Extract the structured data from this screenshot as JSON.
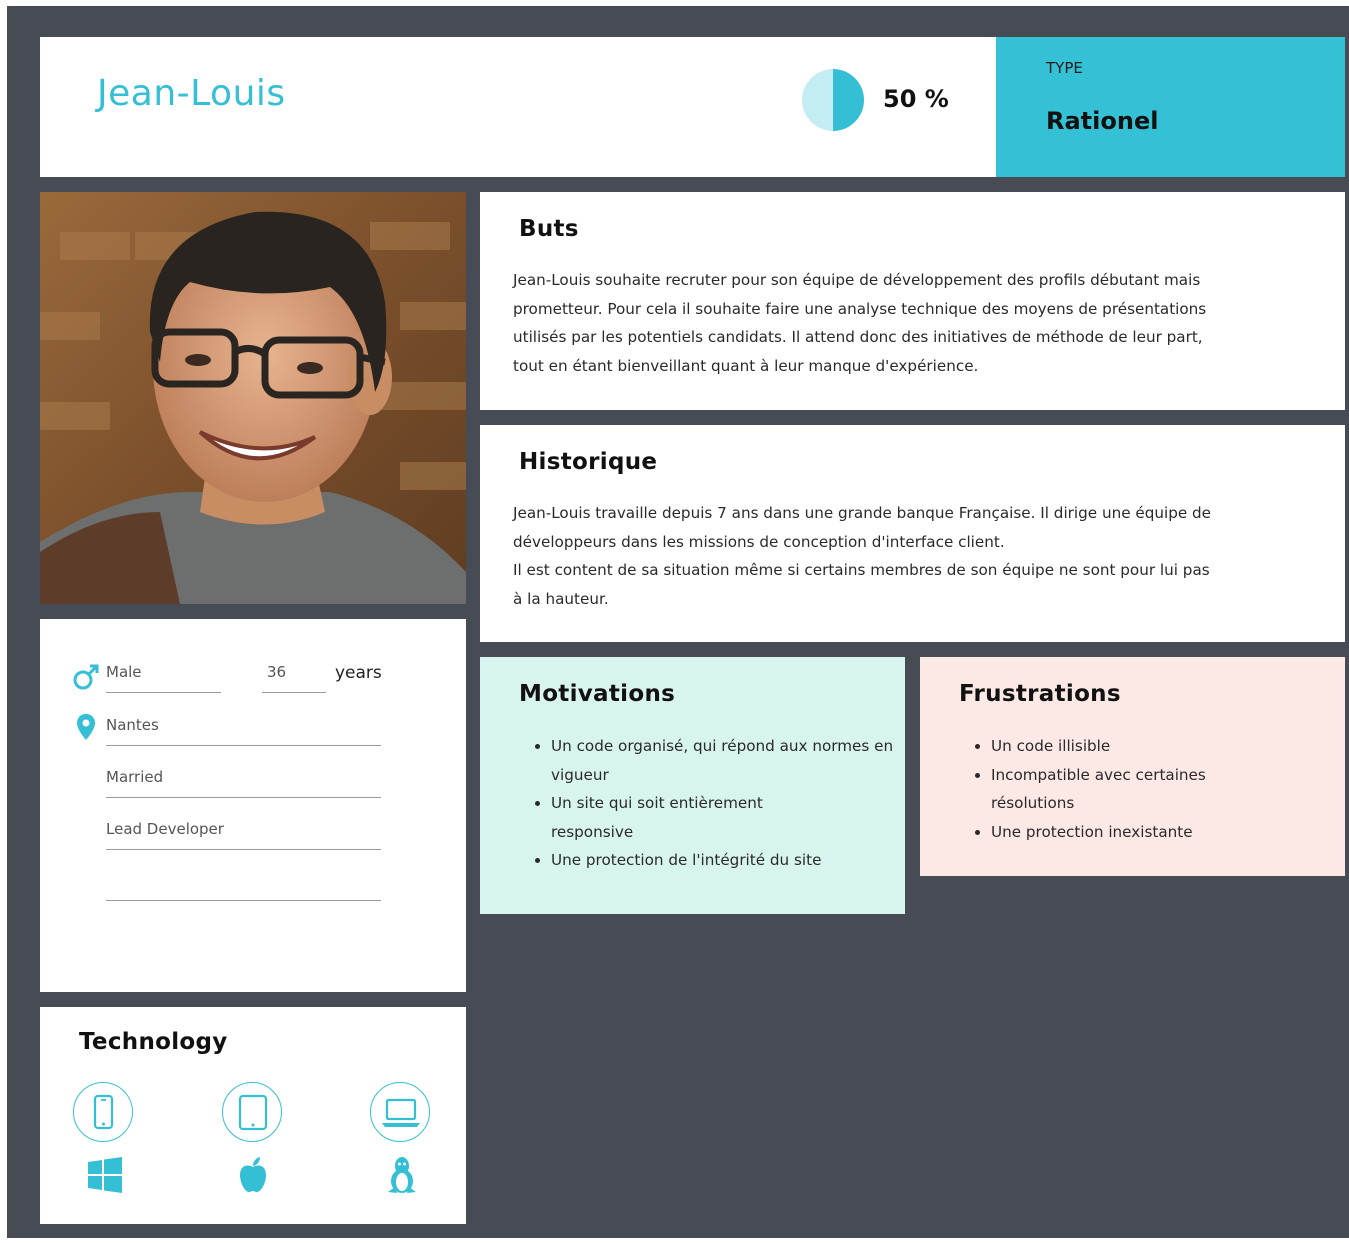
{
  "header": {
    "name": "Jean-Louis",
    "completion_percent": 50,
    "completion_label": "50 %"
  },
  "type": {
    "label": "TYPE",
    "value": "Rationel"
  },
  "colors": {
    "accent": "#35bfd4",
    "type_bg": "#35c1d5",
    "frame_bg": "#474b53",
    "motivations_bg": "#d8f4ee",
    "frustrations_bg": "#fce8e4"
  },
  "info": {
    "gender": "Male",
    "gender_icon": "male-symbol-icon",
    "age": "36",
    "age_unit": "years",
    "city": "Nantes",
    "city_icon": "location-pin-icon",
    "status": "Married",
    "job": "Lead Developer",
    "extra": ""
  },
  "buts": {
    "title": "Buts",
    "lines": [
      "Jean-Louis souhaite recruter pour son équipe de développement des profils débutant mais",
      "prometteur. Pour cela il souhaite faire une analyse technique des moyens de présentations",
      "utilisés par les potentiels candidats. Il attend donc des initiatives de méthode de leur part,",
      "tout en étant bienveillant quant à leur manque d'expérience."
    ]
  },
  "historique": {
    "title": "Historique",
    "lines": [
      "Jean-Louis travaille depuis 7 ans dans une grande banque Française. Il dirige une équipe de",
      "développeurs  dans les missions de conception d'interface client.",
      "Il est content de sa situation même si certains membres de son équipe ne sont pour lui pas",
      "à la hauteur."
    ]
  },
  "motivations": {
    "title": "Motivations",
    "items": [
      "Un code organisé, qui répond aux normes en vigueur",
      "Un site qui soit entièrement responsive",
      "Une protection de l'intégrité du site"
    ]
  },
  "frustrations": {
    "title": "Frustrations",
    "items": [
      "Un code illisible",
      "Incompatible avec certaines résolutions",
      "Une protection inexistante"
    ]
  },
  "technology": {
    "title": "Technology",
    "devices": [
      "smartphone-icon",
      "tablet-icon",
      "laptop-icon"
    ],
    "os": [
      "windows-icon",
      "apple-icon",
      "linux-icon"
    ]
  }
}
